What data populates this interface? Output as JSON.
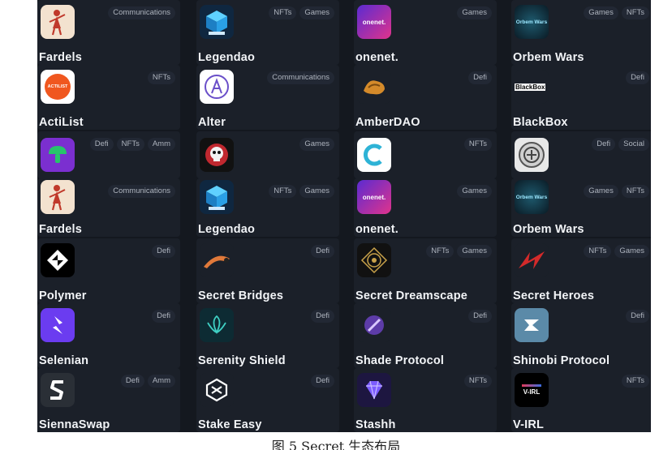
{
  "rows": [
    [
      {
        "name": "Fardels",
        "tags": [
          "Communications"
        ],
        "icon": "fardels-icon"
      },
      {
        "name": "Legendao",
        "tags": [
          "NFTs",
          "Games"
        ],
        "icon": "legendao-icon"
      },
      {
        "name": "onenet.",
        "tags": [
          "Games"
        ],
        "icon": "onenet-icon",
        "logo_text": "onenet."
      },
      {
        "name": "Orbem Wars",
        "tags": [
          "Games",
          "NFTs"
        ],
        "icon": "orbem-wars-icon",
        "logo_text": "Orbem Wars"
      }
    ],
    [
      {
        "name": "ActiList",
        "tags": [
          "NFTs"
        ],
        "icon": "actilist-icon",
        "logo_text": "ACTILIST"
      },
      {
        "name": "Alter",
        "tags": [
          "Communications"
        ],
        "icon": "alter-icon"
      },
      {
        "name": "AmberDAO",
        "tags": [
          "Defi"
        ],
        "icon": "amberdao-icon"
      },
      {
        "name": "BlackBox",
        "tags": [
          "Defi"
        ],
        "icon": "blackbox-icon",
        "logo_text": "BlackBox"
      }
    ],
    [
      {
        "name": "",
        "tags": [
          "Defi",
          "NFTs",
          "Amm"
        ],
        "icon": "mushroom-icon"
      },
      {
        "name": "",
        "tags": [
          "Games"
        ],
        "icon": "skull-icon"
      },
      {
        "name": "",
        "tags": [
          "NFTs"
        ],
        "icon": "c-logo-icon"
      },
      {
        "name": "",
        "tags": [
          "Defi",
          "Social"
        ],
        "icon": "coin-icon"
      }
    ],
    [
      {
        "name": "Fardels",
        "tags": [
          "Communications"
        ],
        "icon": "fardels-icon"
      },
      {
        "name": "Legendao",
        "tags": [
          "NFTs",
          "Games"
        ],
        "icon": "legendao-icon"
      },
      {
        "name": "onenet.",
        "tags": [
          "Games"
        ],
        "icon": "onenet-icon",
        "logo_text": "onenet."
      },
      {
        "name": "Orbem Wars",
        "tags": [
          "Games",
          "NFTs"
        ],
        "icon": "orbem-wars-icon",
        "logo_text": "Orbem Wars"
      }
    ],
    [
      {
        "name": "Polymer",
        "tags": [
          "Defi"
        ],
        "icon": "polymer-icon"
      },
      {
        "name": "Secret Bridges",
        "tags": [
          "Defi"
        ],
        "icon": "secret-bridges-icon"
      },
      {
        "name": "Secret Dreamscape",
        "tags": [
          "NFTs",
          "Games"
        ],
        "icon": "secret-dreamscape-icon"
      },
      {
        "name": "Secret Heroes",
        "tags": [
          "NFTs",
          "Games"
        ],
        "icon": "secret-heroes-icon"
      }
    ],
    [
      {
        "name": "Selenian",
        "tags": [
          "Defi"
        ],
        "icon": "selenian-icon"
      },
      {
        "name": "Serenity Shield",
        "tags": [
          "Defi"
        ],
        "icon": "serenity-shield-icon"
      },
      {
        "name": "Shade Protocol",
        "tags": [
          "Defi"
        ],
        "icon": "shade-protocol-icon"
      },
      {
        "name": "Shinobi Protocol",
        "tags": [
          "Defi"
        ],
        "icon": "shinobi-protocol-icon"
      }
    ],
    [
      {
        "name": "SiennaSwap",
        "tags": [
          "Defi",
          "Amm"
        ],
        "icon": "siennaswap-icon"
      },
      {
        "name": "Stake Easy",
        "tags": [
          "Defi"
        ],
        "icon": "stake-easy-icon"
      },
      {
        "name": "Stashh",
        "tags": [
          "NFTs"
        ],
        "icon": "stashh-icon"
      },
      {
        "name": "V-IRL",
        "tags": [
          "NFTs"
        ],
        "icon": "v-irl-icon",
        "logo_text": "V-IRL"
      }
    ]
  ],
  "caption": "图 5 Secret 生态布局",
  "colors": {
    "background": "#14181f",
    "card": "#1b2029",
    "tag": "#222834",
    "text": "#f2f4f7"
  }
}
